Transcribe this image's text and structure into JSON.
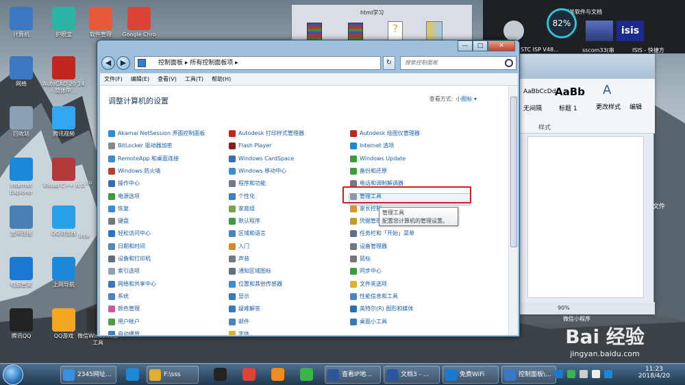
{
  "desktop": {
    "icons": [
      {
        "label": "计算机",
        "color": "#3a78c2"
      },
      {
        "label": "护眼宝",
        "color": "#2bb3a4"
      },
      {
        "label": "软件管理",
        "color": "#e8583a"
      },
      {
        "label": "Google Chro",
        "color": "#db4437"
      },
      {
        "label": "网络",
        "color": "#3a78c2"
      },
      {
        "label": "AutoCAD 20 14 - 简体中...",
        "color": "#c0281f"
      },
      {
        "label": "回收站",
        "color": "#8aa0b4"
      },
      {
        "label": "腾讯视频",
        "color": "#2fa7f2"
      },
      {
        "label": "Internet Explorer",
        "color": "#1e88d8"
      },
      {
        "label": "Visual C++ 6.0",
        "color": "#b33a3a"
      },
      {
        "label": "宽带连接",
        "color": "#4a7fb5"
      },
      {
        "label": "QQ浏览器",
        "color": "#27a2e8"
      },
      {
        "label": "电脑管家",
        "color": "#1a7ad1"
      },
      {
        "label": "上网导航",
        "color": "#1e88d8"
      },
      {
        "label": "腾讯QQ",
        "color": "#222222"
      },
      {
        "label": "QQ游戏",
        "color": "#f5a623"
      },
      {
        "label": "微信Windows版工具",
        "color": "#333333"
      }
    ],
    "partial_labels": [
      "Inte",
      "tu"
    ]
  },
  "bg_window": {
    "title": "html学习"
  },
  "dark_window": {
    "percent": "82%",
    "text1": "机相关软件与文档",
    "text2": "STC ISP V48...",
    "text3": "sscom33(串",
    "text4": "ISIS - 快捷方"
  },
  "word": {
    "styles": [
      "AaBbCcDd",
      "AaBb",
      "A"
    ],
    "style_labels": [
      "无间隔",
      "标题 1",
      "更改样式",
      "编辑"
    ],
    "group_label": "样式",
    "zoom": "90%",
    "side_label": "文件",
    "bottom_label": "微信小程序"
  },
  "cp": {
    "window_buttons": {
      "min": "—",
      "max": "□",
      "close": "✕"
    },
    "nav": {
      "back": "◀",
      "forward": "▶",
      "address": "控制面板 ▸ 所有控制面板项 ▸",
      "refresh": "↻",
      "search_placeholder": "搜索控制面板"
    },
    "menu": [
      "文件(F)",
      "编辑(E)",
      "查看(V)",
      "工具(T)",
      "帮助(H)"
    ],
    "title": "调整计算机的设置",
    "view_label": "查看方式:",
    "view_value": "小图标 ▾",
    "columns": [
      [
        {
          "label": "Akamai NetSession 界面控制面板",
          "color": "#2a8fd6"
        },
        {
          "label": "BitLocker 驱动器加密",
          "color": "#8a8a8a"
        },
        {
          "label": "RemoteApp 和桌面连接",
          "color": "#3a8dd1"
        },
        {
          "label": "Windows 防火墙",
          "color": "#b3412b"
        },
        {
          "label": "操作中心",
          "color": "#2f6fb6"
        },
        {
          "label": "电源选项",
          "color": "#3a9c3a"
        },
        {
          "label": "恢复",
          "color": "#3a8dd1"
        },
        {
          "label": "键盘",
          "color": "#777777"
        },
        {
          "label": "轻松访问中心",
          "color": "#2a72c5"
        },
        {
          "label": "日期和时间",
          "color": "#5b86b3"
        },
        {
          "label": "设备和打印机",
          "color": "#5d6f82"
        },
        {
          "label": "索引选项",
          "color": "#8ea1b6"
        },
        {
          "label": "网络和共享中心",
          "color": "#3a78c2"
        },
        {
          "label": "系统",
          "color": "#4a82c4"
        },
        {
          "label": "颜色管理",
          "color": "#c15f9a"
        },
        {
          "label": "用户帐户",
          "color": "#4a9b4a"
        },
        {
          "label": "自动播放",
          "color": "#3c7fc9"
        }
      ],
      [
        {
          "label": "Autodesk 打印样式管理器",
          "color": "#c0281f"
        },
        {
          "label": "Flash Player",
          "color": "#8f1a1a"
        },
        {
          "label": "Windows CardSpace",
          "color": "#3b6fb4"
        },
        {
          "label": "Windows 移动中心",
          "color": "#3a8dd1"
        },
        {
          "label": "程序和功能",
          "color": "#6c7a89"
        },
        {
          "label": "个性化",
          "color": "#3f7fbf"
        },
        {
          "label": "家庭组",
          "color": "#7aa34a"
        },
        {
          "label": "默认程序",
          "color": "#3a9c3a"
        },
        {
          "label": "区域和语言",
          "color": "#4a82c4"
        },
        {
          "label": "入门",
          "color": "#d58b2a"
        },
        {
          "label": "声音",
          "color": "#6c7a89"
        },
        {
          "label": "通知区域图标",
          "color": "#5d6f82"
        },
        {
          "label": "位置和其他传感器",
          "color": "#3a8dd1"
        },
        {
          "label": "显示",
          "color": "#3a78c2"
        },
        {
          "label": "疑难解答",
          "color": "#3a78c2"
        },
        {
          "label": "邮件",
          "color": "#4a82c4"
        },
        {
          "label": "字体",
          "color": "#e0b030"
        }
      ],
      [
        {
          "label": "Autodesk 绘图仪管理器",
          "color": "#c0281f"
        },
        {
          "label": "Internet 选项",
          "color": "#1e88d8"
        },
        {
          "label": "Windows Update",
          "color": "#3a9c3a"
        },
        {
          "label": "备份和还原",
          "color": "#3a9c3a"
        },
        {
          "label": "电话和调制解调器",
          "color": "#6c7a89"
        },
        {
          "label": "管理工具",
          "color": "#8a9aab"
        },
        {
          "label": "家长控制",
          "color": "#d5962a"
        },
        {
          "label": "凭据管理器",
          "color": "#c69a2a"
        },
        {
          "label": "任务栏和「开始」菜单",
          "color": "#5d6f82"
        },
        {
          "label": "设备管理器",
          "color": "#6c7a89"
        },
        {
          "label": "鼠标",
          "color": "#777777"
        },
        {
          "label": "同步中心",
          "color": "#3a9c3a"
        },
        {
          "label": "文件夹选项",
          "color": "#e0b030"
        },
        {
          "label": "性能信息和工具",
          "color": "#4a82c4"
        },
        {
          "label": "英特尔(R) 图形和媒体",
          "color": "#2a6fb6"
        },
        {
          "label": "桌面小工具",
          "color": "#3a78c2"
        }
      ]
    ],
    "tooltip": {
      "title": "管理工具",
      "desc": "配置您计算机的管理设置。"
    }
  },
  "taskbar": {
    "items": [
      {
        "label": "2345网址...",
        "color": "#3b8fe0"
      },
      {
        "label": "",
        "color": "#1e88d8"
      },
      {
        "label": "F:\\sss",
        "color": "#e0b030"
      },
      {
        "label": "",
        "color": "#222222"
      },
      {
        "label": "",
        "color": "#db4437"
      },
      {
        "label": "",
        "color": "#f08a24"
      },
      {
        "label": "",
        "color": "#3ab54a"
      },
      {
        "label": "查看IP地...",
        "color": "#2b579a"
      },
      {
        "label": "文档3 - ...",
        "color": "#2b579a"
      },
      {
        "label": "免费WiFi",
        "color": "#1a7ad1"
      },
      {
        "label": "控制面板\\...",
        "color": "#3a78c2"
      }
    ],
    "clock_time": "11:23",
    "clock_date": "2018/4/20"
  },
  "watermark": {
    "logo": "Bai  经验",
    "url": "jingyan.baidu.com"
  }
}
